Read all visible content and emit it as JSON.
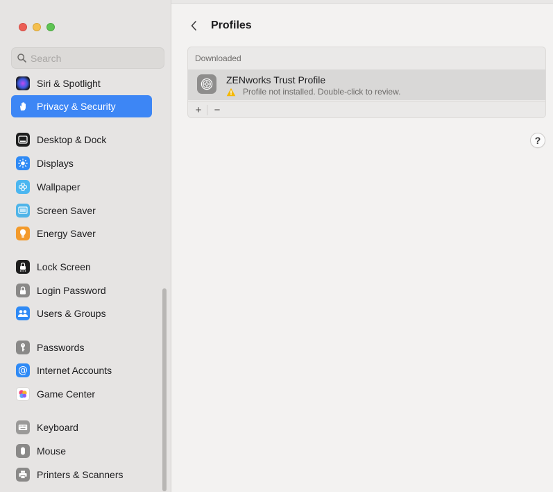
{
  "window": {
    "traffic_lights": [
      "close",
      "minimize",
      "zoom"
    ]
  },
  "sidebar": {
    "search": {
      "placeholder": "Search",
      "value": ""
    },
    "items": [
      {
        "label": "Siri & Spotlight",
        "icon": "siri-icon",
        "color": "#2a2a2e",
        "active": false
      },
      {
        "label": "Privacy & Security",
        "icon": "hand-icon",
        "color": "#3d86f5",
        "active": true
      },
      {
        "label": "Desktop & Dock",
        "icon": "dock-icon",
        "color": "#1e1e1e",
        "active": false
      },
      {
        "label": "Displays",
        "icon": "sun-icon",
        "color": "#2f8af5",
        "active": false
      },
      {
        "label": "Wallpaper",
        "icon": "flower-icon",
        "color": "#4bb6f0",
        "active": false
      },
      {
        "label": "Screen Saver",
        "icon": "screen-saver-icon",
        "color": "#4fb4e8",
        "active": false
      },
      {
        "label": "Energy Saver",
        "icon": "bulb-icon",
        "color": "#f39a2b",
        "active": false
      },
      {
        "label": "Lock Screen",
        "icon": "lock-screen-icon",
        "color": "#1e1e1e",
        "active": false
      },
      {
        "label": "Login Password",
        "icon": "padlock-icon",
        "color": "#8a8988",
        "active": false
      },
      {
        "label": "Users & Groups",
        "icon": "users-icon",
        "color": "#2f8af5",
        "active": false
      },
      {
        "label": "Passwords",
        "icon": "key-icon",
        "color": "#8a8988",
        "active": false
      },
      {
        "label": "Internet Accounts",
        "icon": "at-icon",
        "color": "#2f8af5",
        "active": false
      },
      {
        "label": "Game Center",
        "icon": "game-center-icon",
        "color": "#ffffff",
        "active": false
      },
      {
        "label": "Keyboard",
        "icon": "keyboard-icon",
        "color": "#9a9998",
        "active": false
      },
      {
        "label": "Mouse",
        "icon": "mouse-icon",
        "color": "#8a8988",
        "active": false
      },
      {
        "label": "Printers & Scanners",
        "icon": "printer-icon",
        "color": "#8a8988",
        "active": false
      }
    ]
  },
  "main": {
    "title": "Profiles",
    "section_header": "Downloaded",
    "profile": {
      "name": "ZENworks Trust Profile",
      "status": "Profile not installed. Double-click to review.",
      "icon": "gear-icon"
    },
    "footer": {
      "add_label": "+",
      "remove_label": "−"
    },
    "help_label": "?"
  },
  "colors": {
    "accent": "#3d86f5",
    "warning": "#f5b800"
  }
}
